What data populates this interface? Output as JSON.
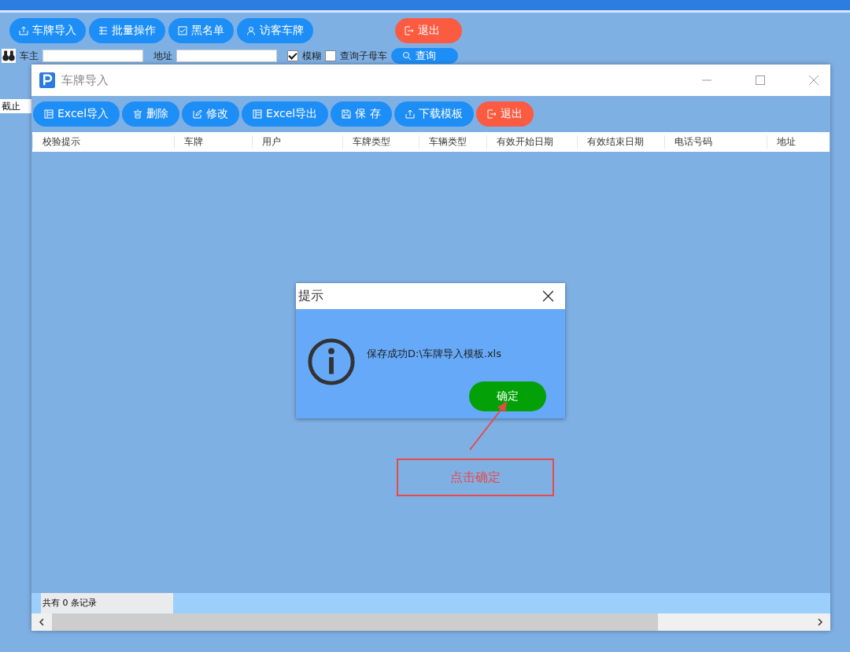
{
  "main_toolbar": {
    "buttons": [
      {
        "label": "车牌导入",
        "kind": "import"
      },
      {
        "label": "批量操作",
        "kind": "batch"
      },
      {
        "label": "黑名单",
        "kind": "check"
      },
      {
        "label": "访客车牌",
        "kind": "person"
      },
      {
        "label": "退出",
        "kind": "exit"
      }
    ]
  },
  "filters": {
    "owner_label": "车主",
    "address_label": "地址",
    "fuzzy": {
      "label": "模糊",
      "checked": true
    },
    "sub_car": {
      "label": "查询子母车",
      "checked": false
    },
    "query_button": "查询",
    "cut_label": "截止"
  },
  "import_window": {
    "title": "车牌导入",
    "buttons": [
      {
        "label": "Excel导入",
        "kind": "excel"
      },
      {
        "label": "删除",
        "kind": "delete"
      },
      {
        "label": "修改",
        "kind": "edit"
      },
      {
        "label": "Excel导出",
        "kind": "excel"
      },
      {
        "label": "保 存",
        "kind": "save"
      },
      {
        "label": "下载模板",
        "kind": "import"
      },
      {
        "label": "退出",
        "kind": "exit"
      }
    ],
    "columns": [
      "校验提示",
      "车牌",
      "用户",
      "车牌类型",
      "车辆类型",
      "有效开始日期",
      "有效结束日期",
      "电话号码",
      "地址"
    ],
    "status": "共有 0 条记录"
  },
  "dialog": {
    "title": "提示",
    "message": "保存成功D:\\车牌导入模板.xls",
    "ok_button": "确定"
  },
  "annotation": {
    "text": "点击确定"
  }
}
